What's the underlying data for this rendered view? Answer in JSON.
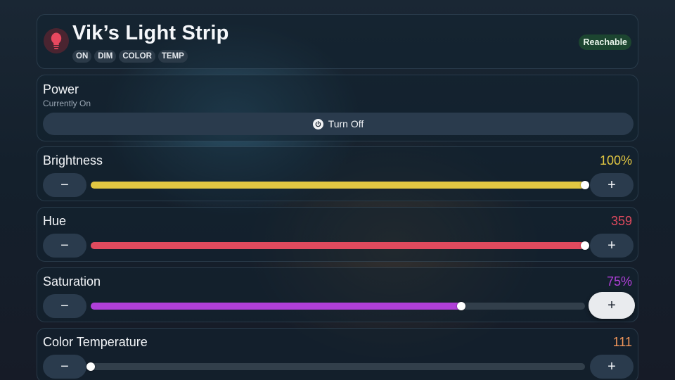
{
  "header": {
    "title": "Vik’s Light Strip",
    "icon": "lightbulb-icon",
    "capabilities": [
      "ON",
      "DIM",
      "COLOR",
      "TEMP"
    ],
    "status": "Reachable"
  },
  "power": {
    "label": "Power",
    "state_text": "Currently On",
    "button_label": "Turn Off",
    "button_icon": "power-icon"
  },
  "sliders": {
    "brightness": {
      "label": "Brightness",
      "value_text": "100%",
      "level": 1.0,
      "color": "#e2c742"
    },
    "hue": {
      "label": "Hue",
      "value_text": "359",
      "level": 1.0,
      "color": "#e04a5e"
    },
    "saturation": {
      "label": "Saturation",
      "value_text": "75%",
      "level": 0.75,
      "color": "#b03fd8"
    },
    "temperature": {
      "label": "Color Temperature",
      "value_text": "111",
      "level": 0.0,
      "color": "#f0955a"
    }
  },
  "controls": {
    "minus_label": "−",
    "plus_label": "+"
  },
  "colors": {
    "accent_reachable": "#1c4530",
    "bulb": "#e8485f"
  }
}
